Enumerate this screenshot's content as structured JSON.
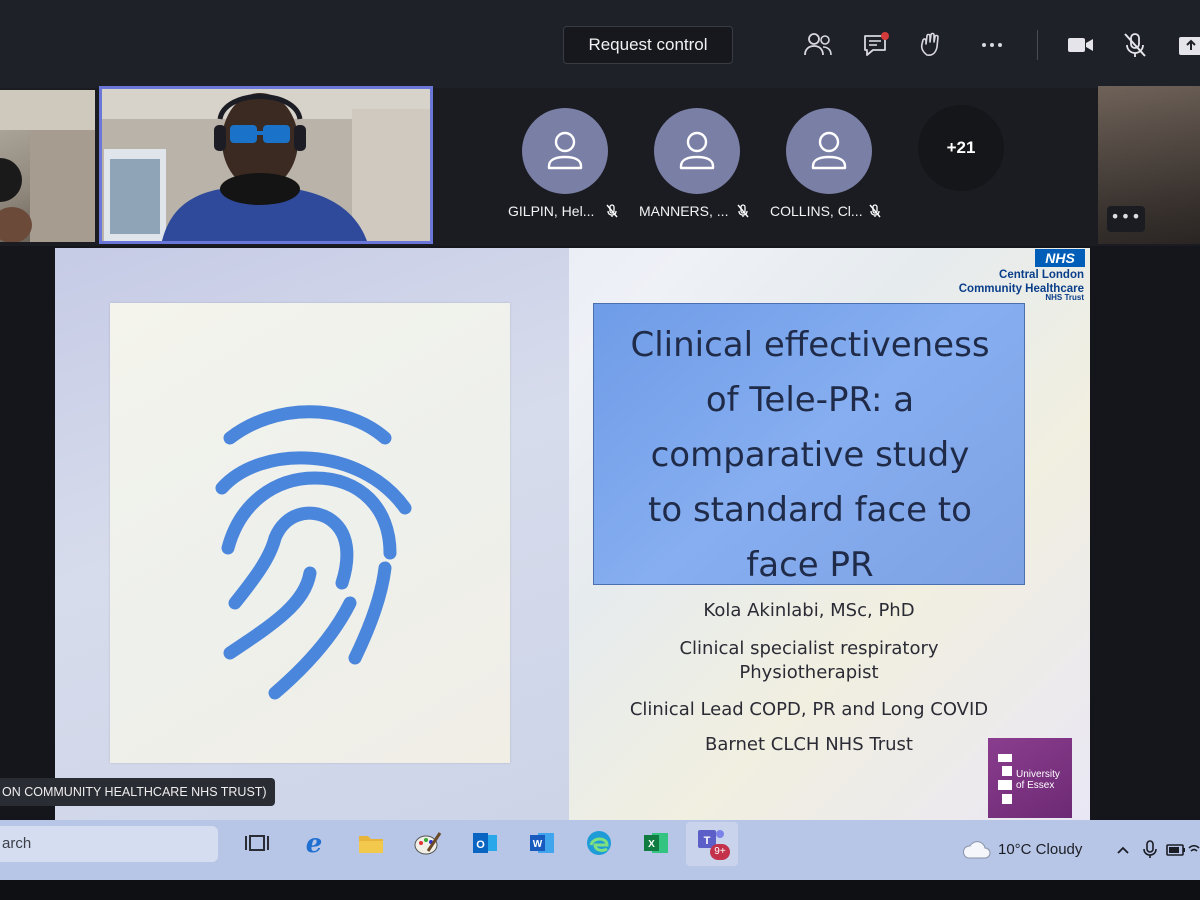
{
  "toolbar": {
    "request_control_label": "Request control",
    "icons": [
      "people-icon",
      "chat-icon",
      "raise-hand-icon",
      "more-icon",
      "camera-icon",
      "mic-muted-icon",
      "share-icon"
    ]
  },
  "participants": [
    {
      "name": "GILPIN, Hel...",
      "muted": true
    },
    {
      "name": "MANNERS, ...",
      "muted": true
    },
    {
      "name": "COLLINS, Cl...",
      "muted": true
    }
  ],
  "more_participants": "+21",
  "tile_more_label": "•••",
  "slide": {
    "title_lines": [
      "Clinical effectiveness",
      "of Tele-PR: a",
      "comparative study",
      "to standard face to",
      "face PR"
    ],
    "author": "Kola Akinlabi, MSc, PhD",
    "role_line1": "Clinical specialist respiratory",
    "role_line2": "Physiotherapist",
    "lead": "Clinical Lead COPD, PR and Long COVID",
    "org": "Barnet CLCH NHS Trust",
    "nhs_logo": "NHS",
    "nhs_org_line1": "Central London",
    "nhs_org_line2": "Community Healthcare",
    "nhs_trust": "NHS Trust",
    "uni_line1": "University",
    "uni_line2": "of Essex"
  },
  "presenter_caption": "ON COMMUNITY HEALTHCARE NHS TRUST)",
  "taskbar": {
    "search_text": "arch",
    "apps": [
      "task-view-icon",
      "internet-explorer-icon",
      "file-explorer-icon",
      "paint-icon",
      "outlook-icon",
      "word-icon",
      "edge-icon",
      "excel-icon",
      "teams-icon"
    ],
    "teams_badge": "9+",
    "weather": "10°C  Cloudy"
  },
  "colors": {
    "topbar": "#1f2128",
    "avatar": "#7a7fa6",
    "title_box": "#7ea2e4",
    "fingerprint": "#4a86dc",
    "nhs_blue": "#005eb8",
    "essex_purple": "#7a3380",
    "taskbar": "#b7c6e6"
  }
}
